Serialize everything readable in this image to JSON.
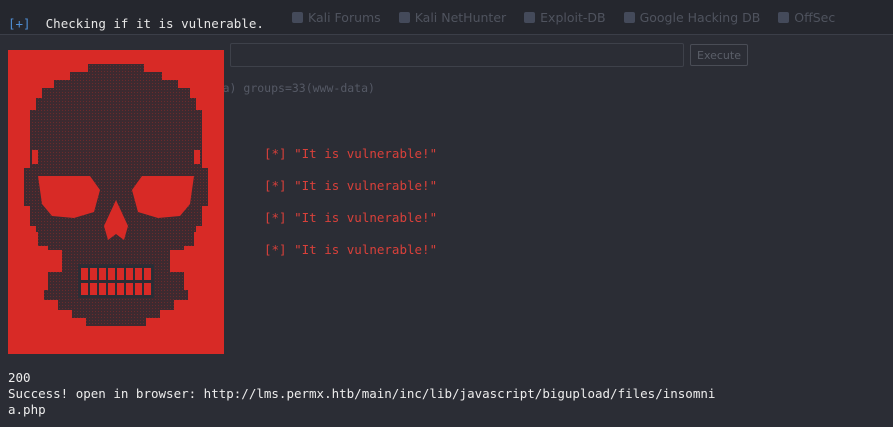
{
  "terminal": {
    "check_prefix": "[+]",
    "check_text": "Checking if it is vulnerable.",
    "vuln_lines": [
      "[*] \"It is vulnerable!\"",
      "[*] \"It is vulnerable!\"",
      "[*] \"It is vulnerable!\"",
      "[*] \"It is vulnerable!\""
    ],
    "status_code": "200",
    "success_text": "Success! open in browser: http://lms.permx.htb/main/inc/lib/javascript/bigupload/files/insomni\na.php"
  },
  "background": {
    "bookmarks": [
      "Kali Forums",
      "Kali NetHunter",
      "Exploit-DB",
      "Google Hacking DB",
      "OffSec"
    ],
    "execute_label": "Execute",
    "uid_text": "uid=33(www-data) gid=33(www-data) groups=33(www-data)"
  },
  "colors": {
    "terminal_bg": "#2b2d35",
    "skull_bg": "#d82a26",
    "skull_fg": "#4a2a30",
    "vuln_text": "#d8403a",
    "prefix_blue": "#4f8fd6"
  },
  "icons": [
    "skull-ascii-art"
  ]
}
